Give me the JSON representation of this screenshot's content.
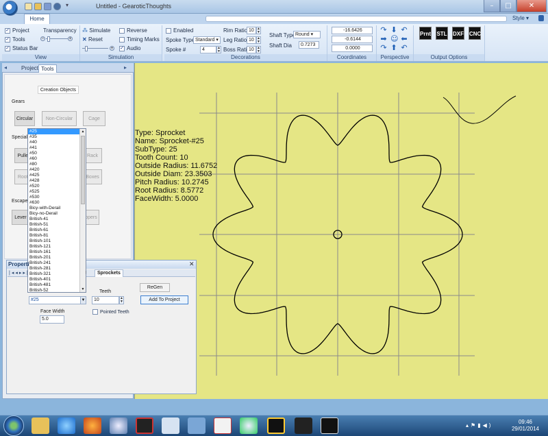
{
  "window": {
    "title": "Untitled - GearoticThoughts",
    "style_menu": "Style ▾"
  },
  "tabs": {
    "home": "Home"
  },
  "view_group": {
    "label": "View",
    "project": "Project",
    "tools": "Tools",
    "status_bar": "Status Bar",
    "transparency": "Transparency"
  },
  "simulation_group": {
    "label": "Simulation",
    "simulate": "Simulate",
    "reverse": "Reverse",
    "reset": "Reset",
    "timing_marks": "Timing Marks",
    "audio": "Audio"
  },
  "decorations_group": {
    "label": "Decorations",
    "enabled": "Enabled",
    "spoke_type_label": "Spoke Type",
    "spoke_type_value": "Standard",
    "spoke_num_label": "Spoke #",
    "spoke_num_value": "4",
    "rim_ratio_label": "Rim Ratio",
    "rim_ratio_value": "10",
    "leg_ratio_label": "Leg Ratio",
    "leg_ratio_value": "10",
    "boss_ratio_label": "Boss Ratio",
    "boss_ratio_value": "10",
    "shaft_type_label": "Shaft Type",
    "shaft_type_value": "Round",
    "shaft_dia_label": "Shaft Dia",
    "shaft_dia_value": "0.7273"
  },
  "coordinates_group": {
    "label": "Coordinates",
    "x": "-16.6426",
    "y": "-0.6144",
    "z": "0.0000"
  },
  "perspective_group": {
    "label": "Perspective"
  },
  "output_group": {
    "label": "Output Options",
    "buttons": [
      "Prnt",
      "STL",
      "DXF",
      "CNC"
    ]
  },
  "left_panel": {
    "tabs": [
      "Project",
      "Tools"
    ],
    "creation_objects": "Creation Objects",
    "gears_label": "Gears",
    "circular": "Circular",
    "non_circular": "Non-Circular",
    "cage": "Cage",
    "special_label": "Special",
    "pulley": "Pulley",
    "rack": "Rack",
    "roots": "Roots",
    "boxes": "Boxes",
    "escapement_label": "Escapem",
    "lever": "Lever",
    "grasshoppers": "ppers"
  },
  "sprocket_list": [
    "#25",
    "#35",
    "#40",
    "#41",
    "#50",
    "#60",
    "#80",
    "#420",
    "#425",
    "#428",
    "#520",
    "#525",
    "#530",
    "#630",
    "Bicy-with-Derail",
    "Bicy-no-Derail",
    "British-41",
    "British-51",
    "British-61",
    "British-81",
    "British-101",
    "British-121",
    "British-161",
    "British-201",
    "British-241",
    "British-281",
    "British-321",
    "British-401",
    "British-481",
    "British-52"
  ],
  "properties": {
    "title": "Properti",
    "tabs": [
      "ng",
      "Sprockets"
    ],
    "selected": "#25",
    "teeth_label": "Teeth",
    "teeth_value": "10",
    "pointed_teeth": "Pointed Teeth",
    "face_width_label": "Face Width",
    "face_width_value": "5.0",
    "regen": "ReGen",
    "add_to_project": "Add To Project"
  },
  "info": [
    "Type: Sprocket",
    "Name: Sprocket-#25",
    "SubType: 25",
    "Tooth Count: 10",
    "Outside Radius: 11.6752",
    "Outside Diam: 23.3503",
    "Pitch Radius: 10.2745",
    "Root Radius: 8.5772",
    "FaceWidth: 5.0000"
  ],
  "clock": {
    "time": "09:46",
    "date": "29/01/2014"
  },
  "colors": {
    "canvas": "#e5e685",
    "gear_line": "#000000",
    "grid": "#8a8a8a",
    "accent": "#3399ff"
  }
}
